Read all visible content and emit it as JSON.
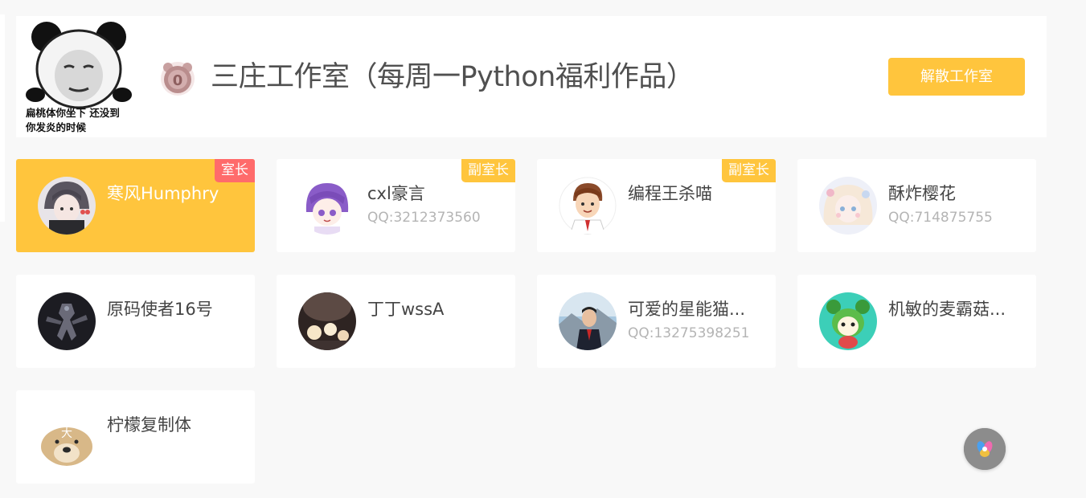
{
  "studio": {
    "avatar_caption_line1": "扁桃体你坐下 还没到",
    "avatar_caption_line2": "你发炎的时候",
    "level": "0",
    "title": "三庄工作室（每周一Python福利作品）",
    "disband_label": "解散工作室"
  },
  "members": [
    {
      "name": "寒风Humphry",
      "qq": "",
      "role": "室长",
      "avatar": "anime-girl-avatar"
    },
    {
      "name": "cxl豪言",
      "qq": "QQ:3212373560",
      "role": "副室长",
      "avatar": "purple-hair-anime-avatar"
    },
    {
      "name": "编程王杀喵",
      "qq": "",
      "role": "副室长",
      "avatar": "cartoon-man-avatar"
    },
    {
      "name": "酥炸樱花",
      "qq": "QQ:714875755",
      "role": "",
      "avatar": "pastel-anime-avatar"
    },
    {
      "name": "原码使者16号",
      "qq": "",
      "role": "",
      "avatar": "robot-mech-avatar"
    },
    {
      "name": "丁丁wssA",
      "qq": "",
      "role": "",
      "avatar": "candles-photo-avatar"
    },
    {
      "name": "可爱的星能猫...",
      "qq": "QQ:13275398251",
      "role": "",
      "avatar": "student-photo-avatar"
    },
    {
      "name": "机敏的麦霸菇...",
      "qq": "",
      "role": "",
      "avatar": "green-cartoon-avatar"
    },
    {
      "name": "柠檬复制体",
      "qq": "",
      "role": "",
      "avatar": "dog-photo-avatar"
    }
  ],
  "float_widget": {
    "icon": "colorful-assistant-icon"
  },
  "colors": {
    "accent": "#ffc53d",
    "owner_badge": "#ff6b6b",
    "muted_text": "#b4b4b4",
    "background": "#f8f8f8"
  }
}
